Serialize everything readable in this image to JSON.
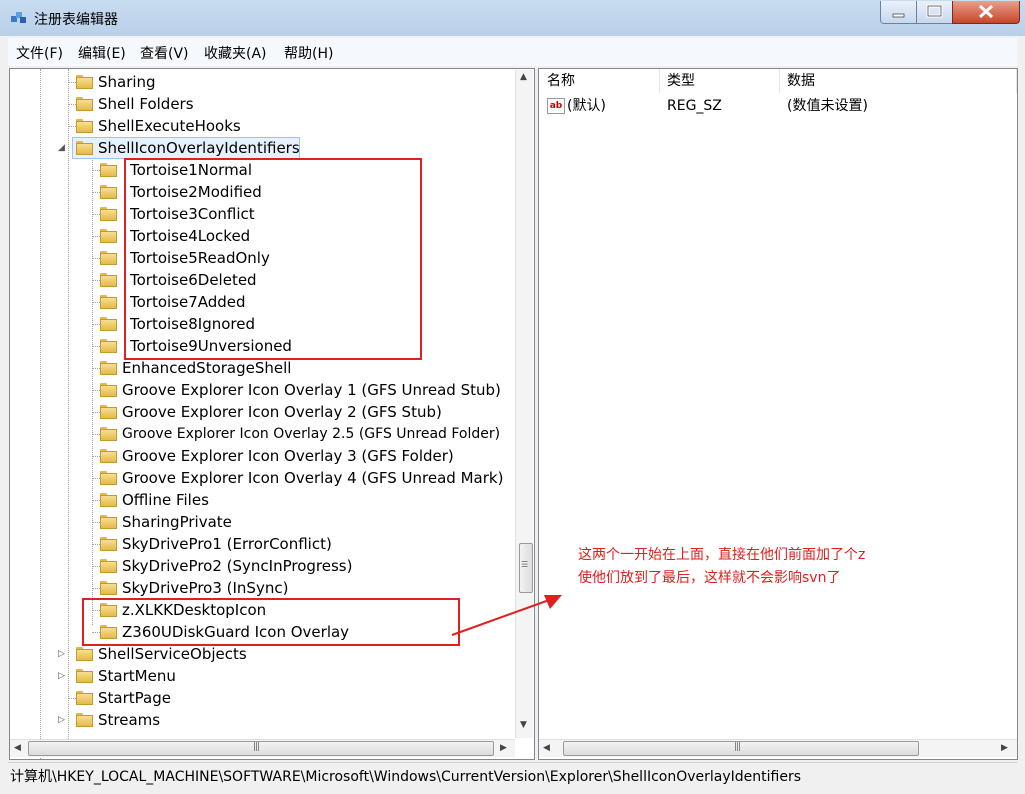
{
  "window": {
    "title": "注册表编辑器"
  },
  "menu": [
    "文件(F)",
    "编辑(E)",
    "查看(V)",
    "收藏夹(A)",
    "帮助(H)"
  ],
  "tree": {
    "items": [
      {
        "label": "Sharing"
      },
      {
        "label": "Shell Folders"
      },
      {
        "label": "ShellExecuteHooks"
      },
      {
        "label": "ShellIconOverlayIdentifiers",
        "expanded": true,
        "selected": true
      },
      {
        "label": "Tortoise1Normal"
      },
      {
        "label": "Tortoise2Modified"
      },
      {
        "label": "Tortoise3Conflict"
      },
      {
        "label": "Tortoise4Locked"
      },
      {
        "label": "Tortoise5ReadOnly"
      },
      {
        "label": "Tortoise6Deleted"
      },
      {
        "label": "Tortoise7Added"
      },
      {
        "label": "Tortoise8Ignored"
      },
      {
        "label": "Tortoise9Unversioned"
      },
      {
        "label": "EnhancedStorageShell"
      },
      {
        "label": "Groove Explorer Icon Overlay 1 (GFS Unread Stub)"
      },
      {
        "label": "Groove Explorer Icon Overlay 2 (GFS Stub)"
      },
      {
        "label": "Groove Explorer Icon Overlay 2.5 (GFS Unread Folder)"
      },
      {
        "label": "Groove Explorer Icon Overlay 3 (GFS Folder)"
      },
      {
        "label": "Groove Explorer Icon Overlay 4 (GFS Unread Mark)"
      },
      {
        "label": "Offline Files"
      },
      {
        "label": "SharingPrivate"
      },
      {
        "label": "SkyDrivePro1 (ErrorConflict)"
      },
      {
        "label": "SkyDrivePro2 (SyncInProgress)"
      },
      {
        "label": "SkyDrivePro3 (InSync)"
      },
      {
        "label": "z.XLKKDesktopIcon"
      },
      {
        "label": "Z360UDiskGuard Icon Overlay"
      },
      {
        "label": "ShellServiceObjects",
        "expandable": true
      },
      {
        "label": "StartMenu",
        "expandable": true
      },
      {
        "label": "StartPage"
      },
      {
        "label": "Streams",
        "expandable": true
      }
    ]
  },
  "list": {
    "columns": [
      "名称",
      "类型",
      "数据"
    ],
    "rows": [
      {
        "name": "(默认)",
        "type": "REG_SZ",
        "data": "(数值未设置)"
      }
    ]
  },
  "status": {
    "path": "计算机\\HKEY_LOCAL_MACHINE\\SOFTWARE\\Microsoft\\Windows\\CurrentVersion\\Explorer\\ShellIconOverlayIdentifiers"
  },
  "annotation": {
    "line1": "这两个一开始在上面，直接在他们前面加了个z",
    "line2": "使他们放到了最后，这样就不会影响svn了",
    "color": "#e02020"
  }
}
